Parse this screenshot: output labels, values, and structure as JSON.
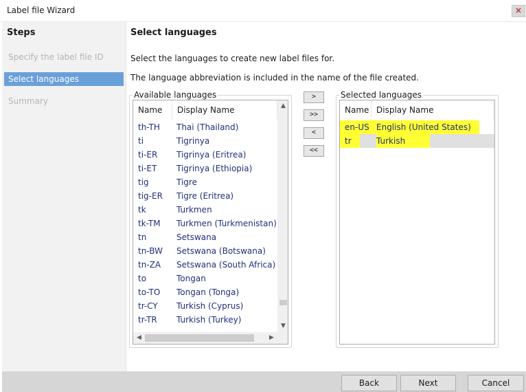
{
  "window": {
    "title": "Label file Wizard",
    "close_glyph": "×"
  },
  "steps": {
    "heading": "Steps",
    "items": [
      {
        "label": "Specify the label file ID",
        "active": false
      },
      {
        "label": "Select languages",
        "active": true
      },
      {
        "label": "Summary",
        "active": false
      }
    ]
  },
  "main": {
    "title": "Select languages",
    "instruction1": "Select the languages to create new label files for.",
    "instruction2": "The language abbreviation is included in the name of the file created."
  },
  "available": {
    "caption": "Available languages",
    "columns": [
      "Name",
      "Display Name"
    ],
    "rows": [
      {
        "name": "th-TH",
        "display": "Thai (Thailand)"
      },
      {
        "name": "ti",
        "display": "Tigrinya"
      },
      {
        "name": "ti-ER",
        "display": "Tigrinya (Eritrea)"
      },
      {
        "name": "ti-ET",
        "display": "Tigrinya (Ethiopia)"
      },
      {
        "name": "tig",
        "display": "Tigre"
      },
      {
        "name": "tig-ER",
        "display": "Tigre (Eritrea)"
      },
      {
        "name": "tk",
        "display": "Turkmen"
      },
      {
        "name": "tk-TM",
        "display": "Turkmen (Turkmenistan)"
      },
      {
        "name": "tn",
        "display": "Setswana"
      },
      {
        "name": "tn-BW",
        "display": "Setswana (Botswana)"
      },
      {
        "name": "tn-ZA",
        "display": "Setswana (South Africa)"
      },
      {
        "name": "to",
        "display": "Tongan"
      },
      {
        "name": "to-TO",
        "display": "Tongan (Tonga)"
      },
      {
        "name": "tr-CY",
        "display": "Turkish (Cyprus)"
      },
      {
        "name": "tr-TR",
        "display": "Turkish (Turkey)"
      }
    ]
  },
  "move_buttons": {
    "add": ">",
    "add_all": ">>",
    "remove": "<",
    "remove_all": "<<"
  },
  "selected": {
    "caption": "Selected languages",
    "columns": [
      "Name",
      "Display Name"
    ],
    "rows": [
      {
        "name": "en-US",
        "display": "English (United States)",
        "highlighted": true
      },
      {
        "name": "tr",
        "display": "Turkish",
        "highlighted": true,
        "selected": true
      }
    ]
  },
  "footer": {
    "back": "Back",
    "next": "Next",
    "cancel": "Cancel"
  },
  "colors": {
    "highlight": "#ffff33",
    "active_step": "#6aa0da",
    "list_text": "#1f2f7a"
  },
  "icons": {
    "up": "chevron-up-icon",
    "down": "chevron-down-icon",
    "left": "chevron-left-icon",
    "right": "chevron-right-icon"
  }
}
